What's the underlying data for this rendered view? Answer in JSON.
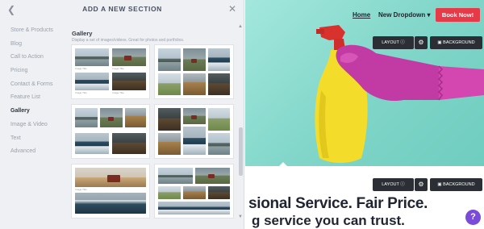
{
  "panel": {
    "title": "ADD A NEW SECTION",
    "back_icon": "chevron-left-icon",
    "close_icon": "close-icon",
    "categories": [
      "Store & Products",
      "Blog",
      "Call to Action",
      "Pricing",
      "Contact & Forms",
      "Feature List",
      "Gallery",
      "Image & Video",
      "Text",
      "Advanced"
    ],
    "active_category": "Gallery",
    "section": {
      "title": "Gallery",
      "description": "Display a set of images/videos. Great for photos and portfolios."
    },
    "caption": "Image Title"
  },
  "preview": {
    "nav": {
      "home": "Home",
      "dropdown": "New Dropdown",
      "cta": "Book Now!"
    },
    "toolbar": {
      "layout": "LAYOUT",
      "background": "BACKGROUND"
    },
    "headline": "sional Service. Fair Price.",
    "subline": "g service you can trust.",
    "help": "?"
  },
  "colors": {
    "accent": "#e63a48",
    "hero": "#8fddd1",
    "toolbar": "#2b2f35",
    "help": "#7a4ad8"
  }
}
